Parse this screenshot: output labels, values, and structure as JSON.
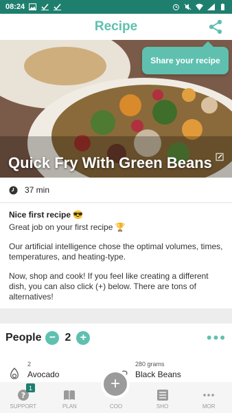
{
  "status_bar": {
    "time": "08:24"
  },
  "header": {
    "title": "Recipe"
  },
  "share_tooltip": {
    "text": "Share your recipe"
  },
  "recipe": {
    "title": "Quick Fry With Green Beans",
    "duration": "37 min",
    "nice_title": "Nice first recipe 😎",
    "nice_text": "Great job on your first recipe 🏆",
    "ai_text": "Our artificial intelligence chose the optimal volumes, times, temperatures, and heating-type.",
    "shop_text": "Now, shop and cook! If you feel like creating a different dish, you can also click (+) below. There are tons of alternatives!"
  },
  "people": {
    "label": "People",
    "minus": "−",
    "count": "2",
    "plus": "+",
    "more": "•••"
  },
  "ingredients": [
    {
      "qty": "2",
      "name": "Avocado",
      "icon": "avocado-icon"
    },
    {
      "qty": "280 grams",
      "name": "Black Beans",
      "icon": "beans-icon"
    }
  ],
  "nav": {
    "support": "SUPPORT",
    "support_badge": "1",
    "plan": "PLAN",
    "cook": "COO",
    "shop": "SHO",
    "more": "MOR",
    "cook_symbol": "+"
  },
  "colors": {
    "accent": "#5fc0b0",
    "status_bar": "#1f7f6f"
  }
}
